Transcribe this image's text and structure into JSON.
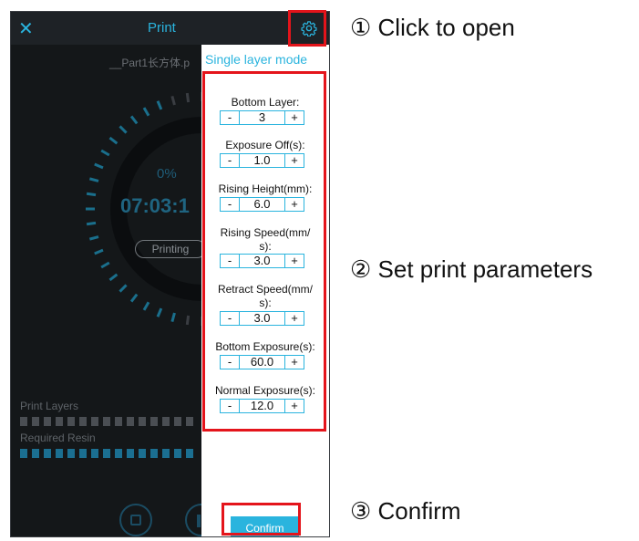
{
  "header": {
    "close_icon": "close-icon",
    "title": "Print",
    "settings_icon": "gear-icon"
  },
  "print_view": {
    "filename": "__Part1长方体.p",
    "progress": "0%",
    "time": "07:03:1",
    "status": "Printing",
    "print_layers_label": "Print Layers",
    "required_resin_label": "Required Resin"
  },
  "panel": {
    "mode": "Single layer mode",
    "params": [
      {
        "label": "Bottom Layer:",
        "value": "3"
      },
      {
        "label": "Exposure Off(s):",
        "value": "1.0"
      },
      {
        "label": "Rising Height(mm):",
        "value": "6.0"
      },
      {
        "label": "Rising Speed(mm/\ns):",
        "value": "3.0"
      },
      {
        "label": "Retract Speed(mm/\ns):",
        "value": "3.0"
      },
      {
        "label": "Bottom Exposure(s):",
        "value": "60.0"
      },
      {
        "label": "Normal Exposure(s):",
        "value": "12.0"
      }
    ],
    "minus": "-",
    "plus": "+",
    "confirm": "Confirm"
  },
  "steps": {
    "step1": "① Click to open",
    "step2": "② Set print parameters",
    "step3": "③ Confirm"
  },
  "colors": {
    "accent": "#2ab4de",
    "highlight": "#e4141b",
    "dark_bg": "#101317"
  }
}
